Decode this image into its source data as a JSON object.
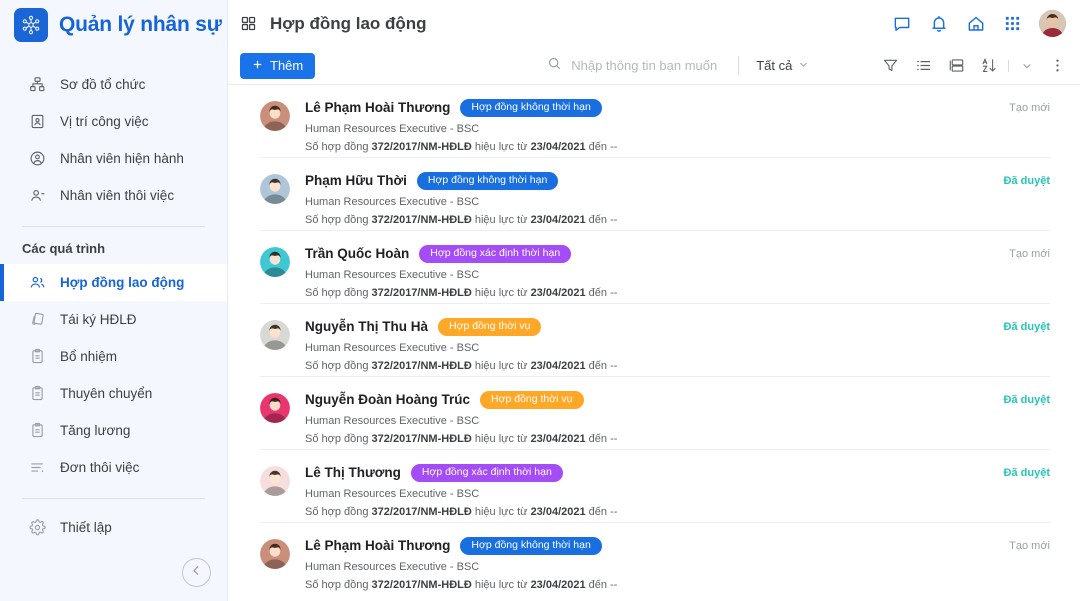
{
  "colors": {
    "brand_blue": "#1565d8",
    "accent_blue": "#1a73e8",
    "badge_blue": "#1a6fe0",
    "badge_purple": "#a44cf6",
    "badge_orange": "#ffa726",
    "status_approved": "#26c6b4",
    "status_new": "#9aa0a6",
    "sidebar_bg": "#f4f7fd"
  },
  "sidebar": {
    "brand": {
      "title": "Quản lý nhân sự",
      "logo_icon": "molecule-icon"
    },
    "items": [
      {
        "label": "Sơ đồ tổ chức",
        "icon": "org-chart-icon",
        "active": false
      },
      {
        "label": "Vị trí công việc",
        "icon": "id-badge-icon",
        "active": false
      },
      {
        "label": "Nhân viên hiện hành",
        "icon": "user-circle-icon",
        "active": false
      },
      {
        "label": "Nhân viên thôi  việc",
        "icon": "user-minus-icon",
        "active": false
      }
    ],
    "group_title": "Các quá trình",
    "group_items": [
      {
        "label": "Hợp đồng lao động",
        "icon": "users-icon",
        "active": true
      },
      {
        "label": "Tái ký HĐLĐ",
        "icon": "documents-copy-icon",
        "active": false
      },
      {
        "label": "Bổ nhiệm",
        "icon": "clipboard-icon",
        "active": false
      },
      {
        "label": "Thuyên chuyển",
        "icon": "clipboard-icon",
        "active": false
      },
      {
        "label": "Tăng lương",
        "icon": "clipboard-icon",
        "active": false
      },
      {
        "label": "Đơn thôi việc",
        "icon": "list-lines-icon",
        "active": false
      }
    ],
    "settings_item": {
      "label": "Thiết lập",
      "icon": "gear-icon"
    },
    "collapse_icon": "arrow-left-circle-icon"
  },
  "topbar": {
    "grid_icon": "apps-grid-icon",
    "title": "Hợp đồng lao động",
    "icons": [
      {
        "name": "chat-icon"
      },
      {
        "name": "bell-icon"
      },
      {
        "name": "home-icon"
      },
      {
        "name": "apps-grid-icon"
      }
    ],
    "avatar": {
      "name": "user-avatar",
      "color": "#b9836c"
    }
  },
  "toolbar": {
    "add_label": "Thêm",
    "add_icon": "plus-icon",
    "search_icon": "search-icon",
    "search_value": "",
    "search_placeholder": "Nhập thông tin bạn muốn tìm",
    "filter_label": "Tất cả",
    "filter_chevron": "chevron-down-icon",
    "icons": [
      {
        "name": "filter-funnel-icon"
      },
      {
        "name": "list-view-icon"
      },
      {
        "name": "board-view-icon"
      },
      {
        "name": "sort-az-icon"
      },
      {
        "name": "chevron-down-icon"
      },
      {
        "name": "more-vertical-icon"
      }
    ]
  },
  "list": {
    "rows": [
      {
        "name": "Lê Phạm Hoài Thương",
        "badge": "Hợp đồng không thời hạn",
        "badge_color": "#1a6fe0",
        "role": "Human Resources Executive - BSC",
        "contract_prefix": "Số hợp đồng ",
        "contract_number": "372/2017/NM-HĐLĐ",
        "contract_mid": " hiệu lực từ ",
        "contract_date": "23/04/2021",
        "contract_suffix": " đến --",
        "status": "Tạo mới",
        "status_type": "new",
        "avatar_color": "#c98f7a"
      },
      {
        "name": "Phạm Hữu Thời",
        "badge": "Hợp đồng không thời hạn",
        "badge_color": "#1a6fe0",
        "role": "Human Resources Executive - BSC",
        "contract_prefix": "Số hợp đồng ",
        "contract_number": "372/2017/NM-HĐLĐ",
        "contract_mid": " hiệu lực từ ",
        "contract_date": "23/04/2021",
        "contract_suffix": " đến --",
        "status": "Đã duyệt",
        "status_type": "approved",
        "avatar_color": "#aec6d8"
      },
      {
        "name": "Trần Quốc Hoàn",
        "badge": "Hợp đồng xác định thời hạn",
        "badge_color": "#a44cf6",
        "role": "Human Resources Executive - BSC",
        "contract_prefix": "Số hợp đồng ",
        "contract_number": "372/2017/NM-HĐLĐ",
        "contract_mid": " hiệu lực từ ",
        "contract_date": "23/04/2021",
        "contract_suffix": " đến --",
        "status": "Tạo mới",
        "status_type": "new",
        "avatar_color": "#3fc8d4"
      },
      {
        "name": "Nguyễn Thị Thu Hà",
        "badge": "Hợp đồng thời vụ",
        "badge_color": "#ffa726",
        "role": "Human Resources Executive - BSC",
        "contract_prefix": "Số hợp đồng ",
        "contract_number": "372/2017/NM-HĐLĐ",
        "contract_mid": " hiệu lực từ ",
        "contract_date": "23/04/2021",
        "contract_suffix": " đến --",
        "status": "Đã duyệt",
        "status_type": "approved",
        "avatar_color": "#d8d8d4"
      },
      {
        "name": "Nguyễn Đoàn Hoàng Trúc",
        "badge": "Hợp đồng thời vụ",
        "badge_color": "#ffa726",
        "role": "Human Resources Executive - BSC",
        "contract_prefix": "Số hợp đồng ",
        "contract_number": "372/2017/NM-HĐLĐ",
        "contract_mid": " hiệu lực từ ",
        "contract_date": "23/04/2021",
        "contract_suffix": " đến --",
        "status": "Đã duyệt",
        "status_type": "approved",
        "avatar_color": "#e8376f"
      },
      {
        "name": "Lê Thị Thương",
        "badge": "Hợp đồng xác định thời hạn",
        "badge_color": "#a44cf6",
        "role": "Human Resources Executive - BSC",
        "contract_prefix": "Số hợp đồng ",
        "contract_number": "372/2017/NM-HĐLĐ",
        "contract_mid": " hiệu lực từ ",
        "contract_date": "23/04/2021",
        "contract_suffix": " đến --",
        "status": "Đã duyệt",
        "status_type": "approved",
        "avatar_color": "#f6dede"
      },
      {
        "name": "Lê Phạm Hoài Thương",
        "badge": "Hợp đồng không thời hạn",
        "badge_color": "#1a6fe0",
        "role": "Human Resources Executive - BSC",
        "contract_prefix": "Số hợp đồng ",
        "contract_number": "372/2017/NM-HĐLĐ",
        "contract_mid": " hiệu lực từ ",
        "contract_date": "23/04/2021",
        "contract_suffix": " đến --",
        "status": "Tạo mới",
        "status_type": "new",
        "avatar_color": "#c98f7a"
      }
    ]
  }
}
